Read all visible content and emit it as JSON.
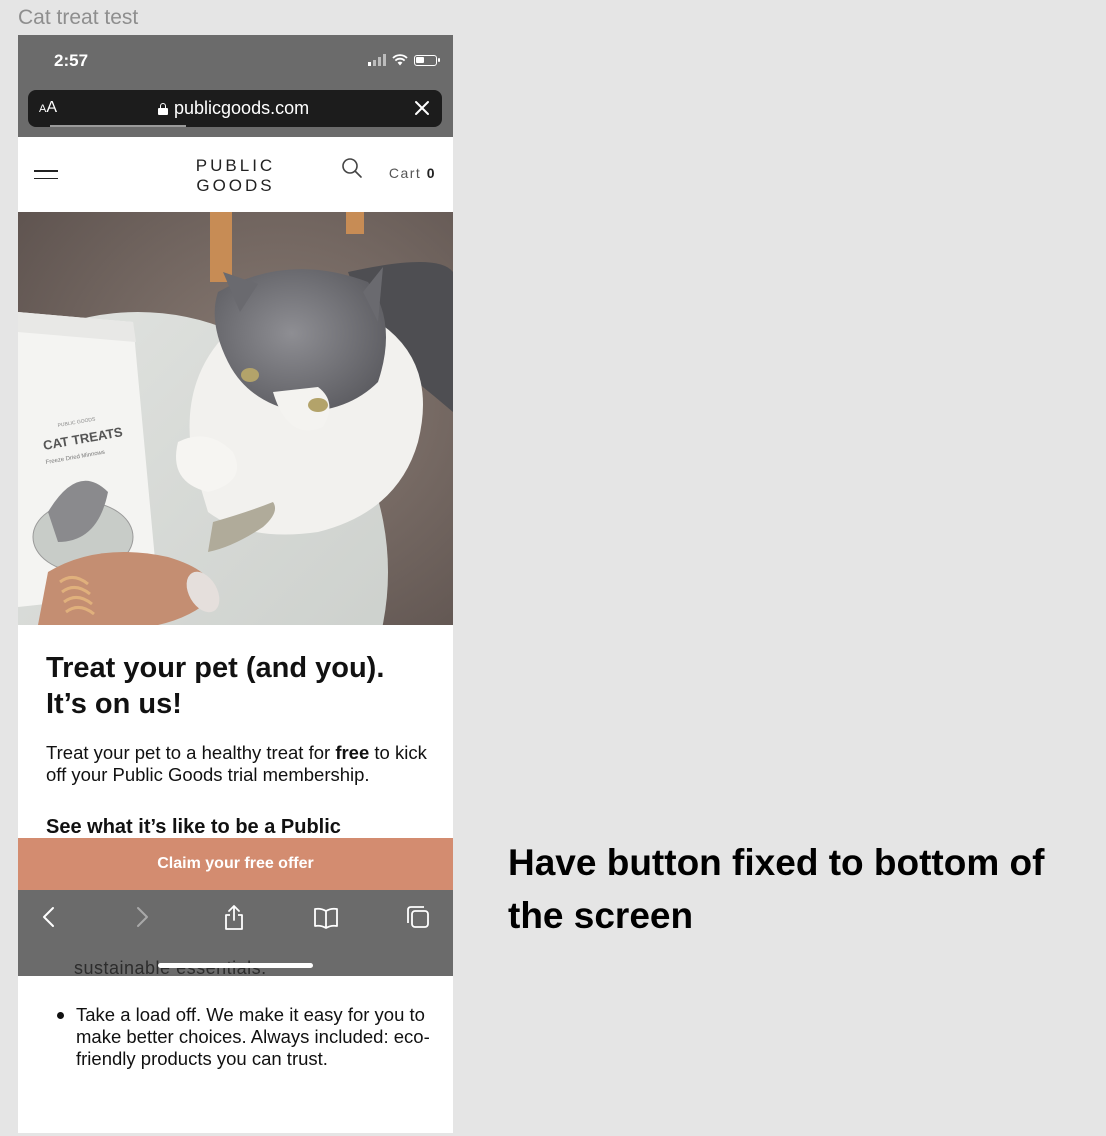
{
  "frame_title": "Cat treat test",
  "status_bar": {
    "time": "2:57"
  },
  "browser": {
    "text_size_label": "A",
    "text_size_label_small": "A",
    "url": "publicgoods.com"
  },
  "site_header": {
    "logo_line1": "PUBLIC",
    "logo_line2": "GOODS",
    "cart_label": "Cart",
    "cart_count": "0"
  },
  "hero": {
    "bag_brand": "PUBLIC GOODS",
    "bag_title": "CAT TREATS",
    "bag_subtitle": "Freeze Dried Minnows"
  },
  "content": {
    "headline_line1": "Treat your pet (and you).",
    "headline_line2": "It’s on us!",
    "para_before": "Treat your pet to a healthy treat for ",
    "para_bold": "free",
    "para_after": " to kick off your Public Goods trial membership.",
    "subhead": "See what it’s like to be a Public"
  },
  "cta": {
    "label": "Claim your free offer"
  },
  "hidden_fragment": "sustainable essentials.",
  "bullets": [
    "Take a load off. We make it easy for you to make better choices. Always included: eco-friendly products you can trust."
  ],
  "annotation": "Have button fixed to bottom of the screen",
  "colors": {
    "cta": "#d38c70",
    "browser_chrome": "#6b6b6b",
    "canvas": "#e5e5e5"
  },
  "icons": [
    "hamburger-icon",
    "search-icon",
    "lock-icon",
    "close-icon",
    "back-icon",
    "forward-icon",
    "share-icon",
    "bookmarks-icon",
    "tabs-icon"
  ]
}
